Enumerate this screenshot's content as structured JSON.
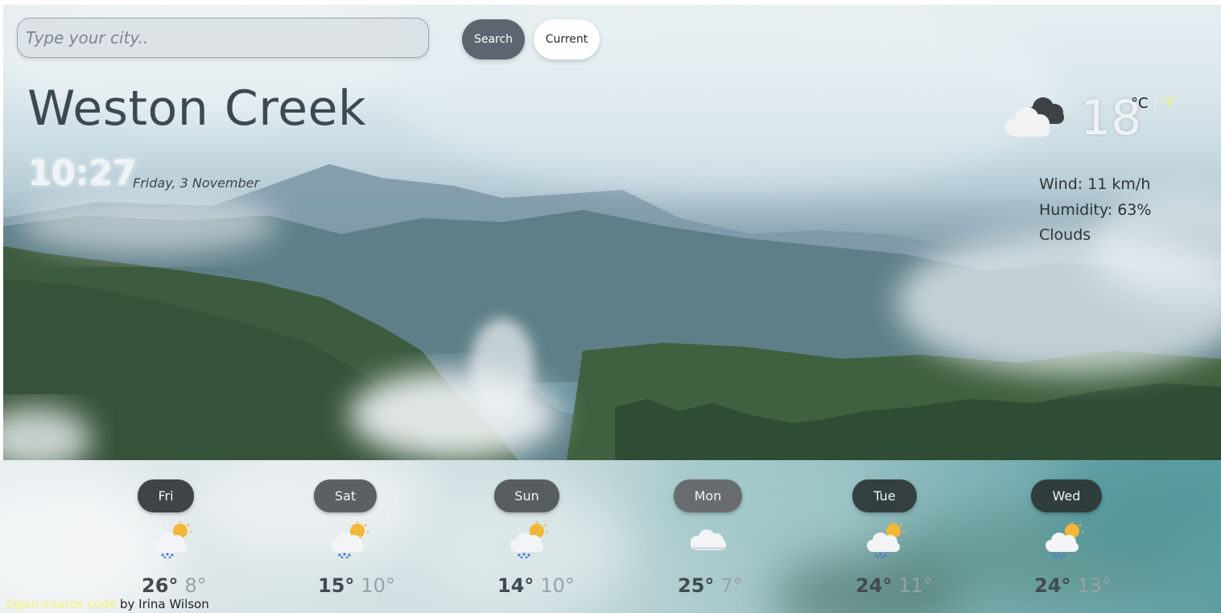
{
  "search": {
    "placeholder": "Type your city..",
    "search_label": "Search",
    "current_label": "Current"
  },
  "location": {
    "city": "Weston Creek",
    "time": "10:27",
    "date": "Friday, 3 November"
  },
  "current": {
    "icon": "cloudy-icon",
    "temperature": "18",
    "unit_c": "°C",
    "unit_sep": "|",
    "unit_f": "°F",
    "wind": "Wind: 11 km/h",
    "humidity": "Humidity: 63%",
    "description": "Clouds"
  },
  "forecast": [
    {
      "day": "Fri",
      "icon": "partly-sunny-rain-icon",
      "max": "26°",
      "min": "8°"
    },
    {
      "day": "Sat",
      "icon": "partly-sunny-rain-icon",
      "max": "15°",
      "min": "10°"
    },
    {
      "day": "Sun",
      "icon": "partly-sunny-rain-icon",
      "max": "14°",
      "min": "10°"
    },
    {
      "day": "Mon",
      "icon": "cloud-icon",
      "max": "25°",
      "min": "7°"
    },
    {
      "day": "Tue",
      "icon": "partly-sunny-rain-icon",
      "max": "24°",
      "min": "11°"
    },
    {
      "day": "Wed",
      "icon": "partly-sunny-rain-icon",
      "max": "24°",
      "min": "13°"
    }
  ],
  "footer": {
    "link_text": "Open-source code",
    "author_text": " by Irina Wilson"
  },
  "colors": {
    "link": "#f5f07a",
    "unit_f": "#f3f07a",
    "search_button": "#5f6570"
  }
}
